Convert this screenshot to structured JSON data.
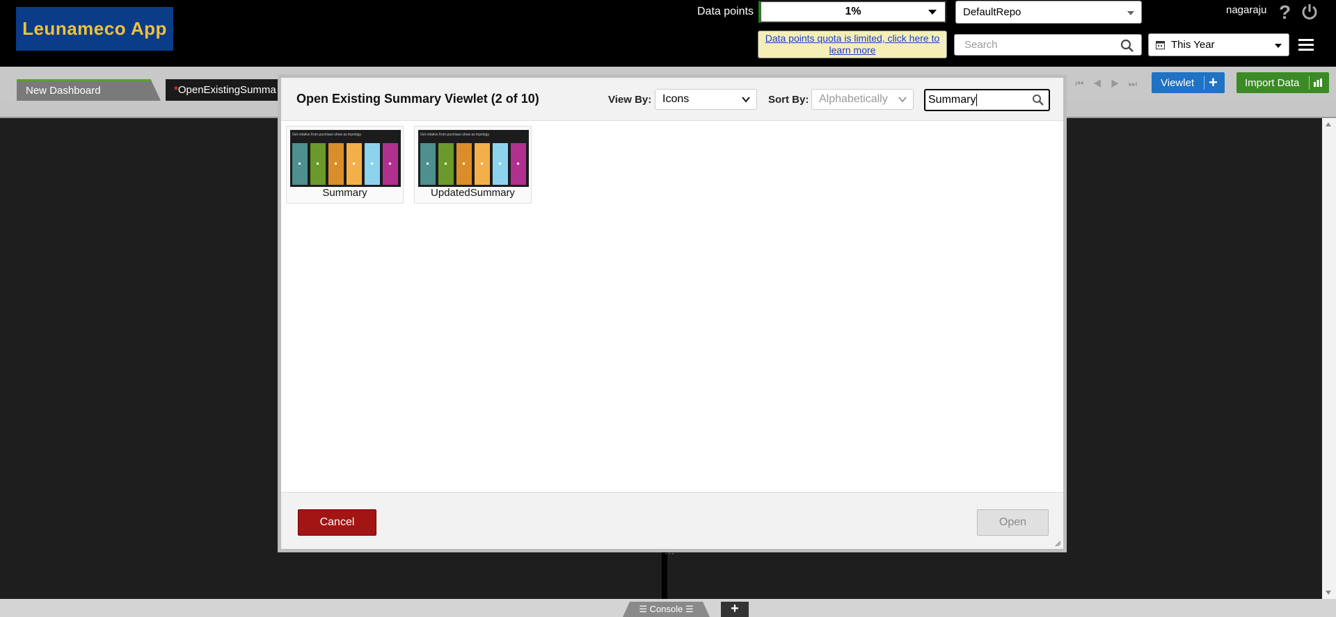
{
  "app": {
    "logo_text": "Leunameco App",
    "colors": {
      "logo_bg": "#0a3c87",
      "logo_text": "#f0c23a",
      "accent_green": "#3a8b25",
      "accent_blue": "#1f72c4",
      "cancel_red": "#a31414"
    }
  },
  "header": {
    "data_points_label": "Data points",
    "data_points_value": "1%",
    "repo": "DefaultRepo",
    "quota_link": "Data points quota is limited, click here to learn more",
    "search_placeholder": "Search",
    "time_range": "This Year",
    "user": "nagaraju",
    "icons": [
      "help-icon",
      "power-icon",
      "menu-icon",
      "search-icon",
      "calendar-icon"
    ]
  },
  "tabs": [
    {
      "label": "New Dashboard",
      "modified": false
    },
    {
      "label": "OpenExistingSumma",
      "modified": true,
      "marker": "*"
    }
  ],
  "toolbar": {
    "viewlet_label": "Viewlet",
    "viewlet_plus": "+",
    "import_label": "Import Data"
  },
  "modal": {
    "title": "Open Existing Summary Viewlet (2 of 10)",
    "view_by_label": "View By:",
    "view_by_value": "Icons",
    "sort_by_label": "Sort By:",
    "sort_by_value": "Alphabetically",
    "search_value": "Summary",
    "items": [
      {
        "label": "Summary",
        "thumb_caption": "Get relative from purchase show as topology"
      },
      {
        "label": "UpdatedSummary",
        "thumb_caption": "Get relative from purchase show as topology"
      }
    ],
    "thumb_bar_colors": [
      "#4e8f8f",
      "#6b9a2a",
      "#d98e2b",
      "#f3b04a",
      "#8ed3ee",
      "#b0308f"
    ],
    "cancel_label": "Cancel",
    "open_label": "Open"
  },
  "bottom": {
    "console_label": "Console",
    "add_label": "+"
  }
}
